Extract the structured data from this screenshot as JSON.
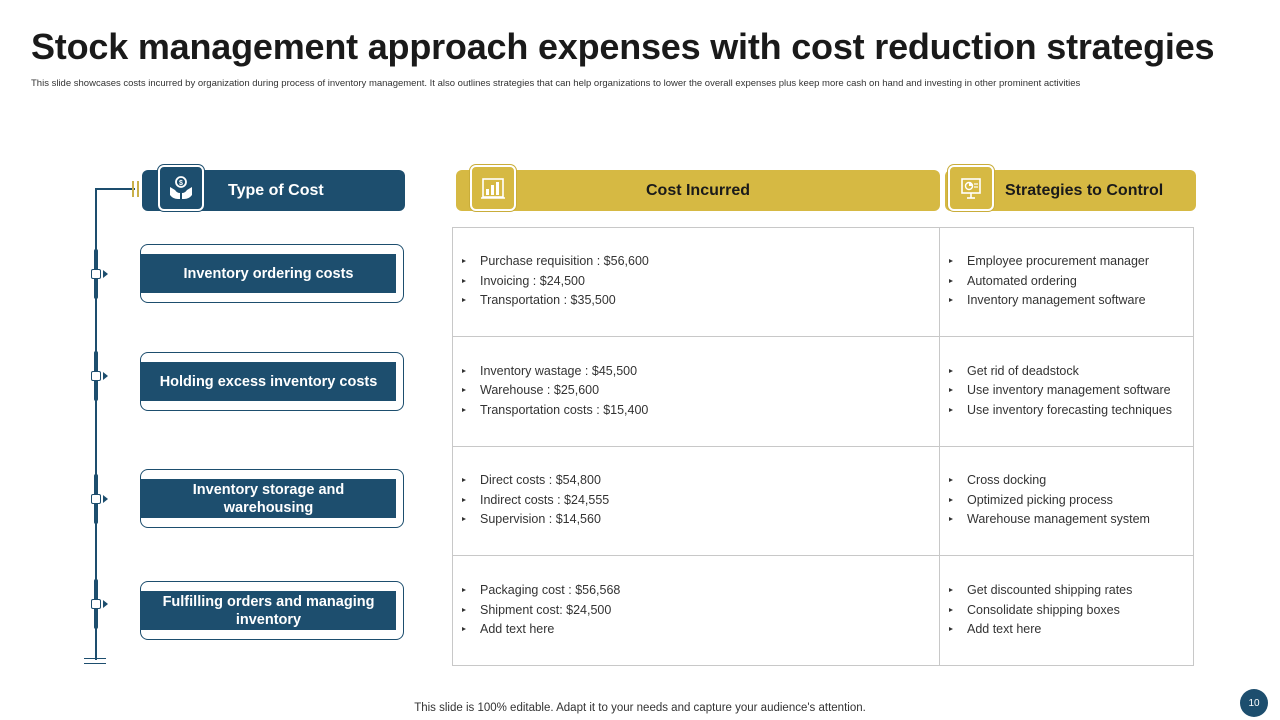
{
  "title": "Stock management approach expenses with cost reduction strategies",
  "subtitle": "This slide showcases costs incurred by organization during process of inventory management. It also outlines strategies that can help organizations to lower the overall expenses plus keep more cash on hand and investing in other prominent activities",
  "headers": {
    "type": "Type of Cost",
    "cost": "Cost Incurred",
    "strategy": "Strategies to Control"
  },
  "icons": {
    "type": "hands-money-icon",
    "cost": "building-chart-icon",
    "strategy": "presentation-board-icon"
  },
  "rows": [
    {
      "type": "Inventory ordering costs",
      "costs": [
        "Purchase requisition : $56,600",
        "Invoicing  : $24,500",
        "Transportation  : $35,500"
      ],
      "strategies": [
        "Employee procurement manager",
        "Automated ordering",
        "Inventory  management  software"
      ]
    },
    {
      "type": "Holding excess inventory costs",
      "costs": [
        "Inventory  wastage  : $45,500",
        "Warehouse  : $25,600",
        "Transportation  costs : $15,400"
      ],
      "strategies": [
        "Get rid of deadstock",
        "Use inventory  management software",
        "Use inventory  forecasting techniques"
      ]
    },
    {
      "type": "Inventory storage and warehousing",
      "costs": [
        "Direct costs : $54,800",
        "Indirect costs : $24,555",
        "Supervision  : $14,560"
      ],
      "strategies": [
        "Cross docking",
        "Optimized picking process",
        "Warehouse management system"
      ]
    },
    {
      "type": "Fulfilling orders and managing inventory",
      "costs": [
        "Packaging cost : $56,568",
        "Shipment cost: $24,500",
        "Add text here"
      ],
      "strategies": [
        "Get discounted shipping rates",
        "Consolidate  shipping boxes",
        "Add text here"
      ]
    }
  ],
  "footer": "This slide is 100% editable. Adapt it to your needs and capture your audience's attention.",
  "page_number": "10",
  "colors": {
    "navy": "#1d4e6e",
    "gold": "#d6b943"
  }
}
